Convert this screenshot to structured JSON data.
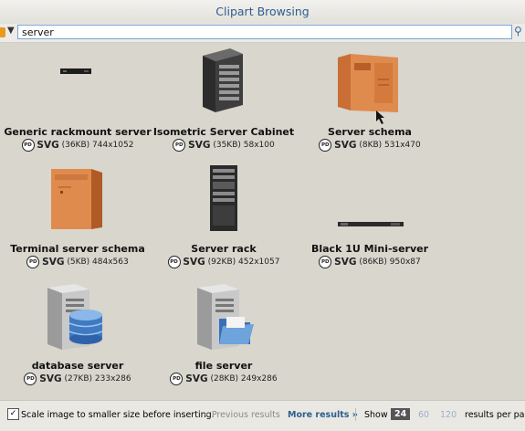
{
  "window": {
    "title": "Clipart Browsing"
  },
  "search": {
    "query": "server"
  },
  "results": [
    {
      "name": "Generic rackmount server",
      "license": "PD",
      "format": "SVG",
      "size": "(36KB)",
      "dimensions": "744x1052",
      "icon": "rackmount-server-icon"
    },
    {
      "name": "Isometric Server Cabinet",
      "license": "PD",
      "format": "SVG",
      "size": "(35KB)",
      "dimensions": "58x100",
      "icon": "server-cabinet-icon"
    },
    {
      "name": "Server schema",
      "license": "PD",
      "format": "SVG",
      "size": "(8KB)",
      "dimensions": "531x470",
      "icon": "server-schema-icon"
    },
    {
      "name": "Terminal server schema",
      "license": "PD",
      "format": "SVG",
      "size": "(5KB)",
      "dimensions": "484x563",
      "icon": "terminal-server-icon"
    },
    {
      "name": "Server rack",
      "license": "PD",
      "format": "SVG",
      "size": "(92KB)",
      "dimensions": "452x1057",
      "icon": "server-rack-icon"
    },
    {
      "name": "Black 1U Mini-server",
      "license": "PD",
      "format": "SVG",
      "size": "(86KB)",
      "dimensions": "950x87",
      "icon": "mini-server-icon"
    },
    {
      "name": "database server",
      "license": "PD",
      "format": "SVG",
      "size": "(27KB)",
      "dimensions": "233x286",
      "icon": "database-server-icon"
    },
    {
      "name": "file server",
      "license": "PD",
      "format": "SVG",
      "size": "(28KB)",
      "dimensions": "249x286",
      "icon": "file-server-icon"
    }
  ],
  "footer": {
    "scale_checkbox_label": "Scale image to smaller size before inserting.",
    "scale_checked": true,
    "prev_label": "« Previous results",
    "more_label": "More results »",
    "show_label": "Show",
    "per_page_options": [
      "24",
      "60",
      "120"
    ],
    "per_page_selected": "24",
    "per_page_suffix": "results per page"
  }
}
